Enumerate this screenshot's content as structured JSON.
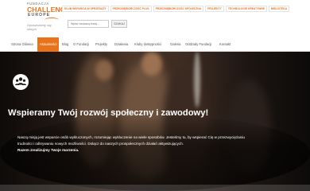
{
  "logo": {
    "line1": "FUNDACJA",
    "line2": "CHALLENGE",
    "line3": "EUROPE",
    "tagline": "Opuszczamy się silnym"
  },
  "top_links": [
    "KLUB WSPARCIA W SPRZEDAŻY",
    "PRZEDSIĘBIORCZOŚĆ PLUS",
    "PRZEDSIĘBIORCZOŚĆ SPOŁECZNA",
    "PROJEKTY",
    "TECHNOLOGIE KREATYWNE",
    "BIBLIOTEKA"
  ],
  "search": {
    "placeholder": "Wpisz szukaną frazę...",
    "button": "SZUKAJ"
  },
  "nav": [
    "Strona Główna",
    "Aktualności",
    "Blog",
    "O Fundacji",
    "Projekty",
    "Działania",
    "Kluby dostępności",
    "Galeria",
    "Oddziały Fundacji",
    "Kontakt"
  ],
  "hero": {
    "title": "Wspieramy Twój rozwój społeczny i zawodowy!",
    "line1": "Naszą misją jest wsparcie osób wykluczonych, rozumiejąc wykluczenie na wiele sposobów. Jesteśmy tu, by wspierać Cię w przezwyciężaniu",
    "line2": "trudności i odkrywaniu nowych możliwości. Dołącz do naszych prospołecznych działań aktywizujących.",
    "line3": "Razem zrealizujmy Twoje marzenia."
  },
  "colors": {
    "accent": "#e8731b"
  },
  "icons": {
    "hero_icon": "people-group-icon"
  }
}
